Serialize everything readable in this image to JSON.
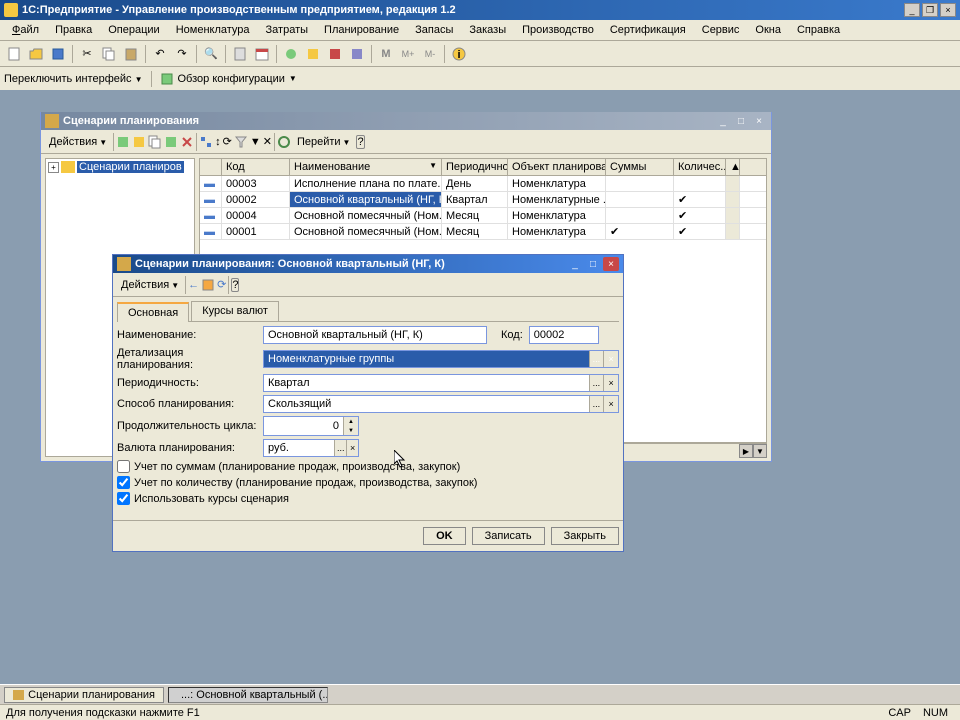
{
  "app": {
    "title": "1С:Предприятие - Управление производственным предприятием, редакция 1.2"
  },
  "menu": {
    "file": "Файл",
    "edit": "Правка",
    "operations": "Операции",
    "nomenclature": "Номенклатура",
    "costs": "Затраты",
    "planning": "Планирование",
    "stocks": "Запасы",
    "orders": "Заказы",
    "production": "Производство",
    "certification": "Сертификация",
    "service": "Сервис",
    "windows": "Окна",
    "help": "Справка"
  },
  "toolbar2": {
    "switch_interface": "Переключить интерфейс",
    "config_overview": "Обзор конфигурации"
  },
  "list_window": {
    "title": "Сценарии планирования",
    "actions": "Действия",
    "go_to": "Перейти",
    "tree_root": "Сценарии планиров",
    "columns": {
      "code": "Код",
      "name": "Наименование",
      "period": "Периодично...",
      "object": "Объект планирова...",
      "sums": "Суммы",
      "qty": "Количес..."
    },
    "rows": [
      {
        "code": "00003",
        "name": "Исполнение плана по плате...",
        "period": "День",
        "object": "Номенклатура",
        "sum": false,
        "qty": false
      },
      {
        "code": "00002",
        "name": "Основной квартальный (НГ, К)",
        "period": "Квартал",
        "object": "Номенклатурные ...",
        "sum": false,
        "qty": true,
        "selected": true
      },
      {
        "code": "00004",
        "name": "Основной помесячный (Ном...",
        "period": "Месяц",
        "object": "Номенклатура",
        "sum": false,
        "qty": true
      },
      {
        "code": "00001",
        "name": "Основной помесячный (Ном...",
        "period": "Месяц",
        "object": "Номенклатура",
        "sum": true,
        "qty": true
      }
    ]
  },
  "dialog": {
    "title": "Сценарии планирования: Основной квартальный (НГ, К)",
    "actions": "Действия",
    "tabs": {
      "main": "Основная",
      "rates": "Курсы валют"
    },
    "fields": {
      "name_label": "Наименование:",
      "name_value": "Основной квартальный (НГ, К)",
      "code_label": "Код:",
      "code_value": "00002",
      "detail_label": "Детализация планирования:",
      "detail_value": "Номенклатурные группы",
      "period_label": "Периодичность:",
      "period_value": "Квартал",
      "method_label": "Способ планирования:",
      "method_value": "Скользящий",
      "cycle_label": "Продолжительность цикла:",
      "cycle_value": "0",
      "currency_label": "Валюта планирования:",
      "currency_value": "руб."
    },
    "checks": {
      "sums": "Учет по суммам (планирование продаж, производства, закупок)",
      "qty": "Учет по количеству (планирование продаж, производства, закупок)",
      "rates": "Использовать курсы сценария"
    },
    "buttons": {
      "ok": "OK",
      "save": "Записать",
      "close": "Закрыть"
    }
  },
  "taskbar": {
    "item1": "Сценарии планирования",
    "item2": "...: Основной квартальный (..."
  },
  "statusbar": {
    "text": "Для получения подсказки нажмите F1",
    "cap": "CAP",
    "num": "NUM"
  }
}
